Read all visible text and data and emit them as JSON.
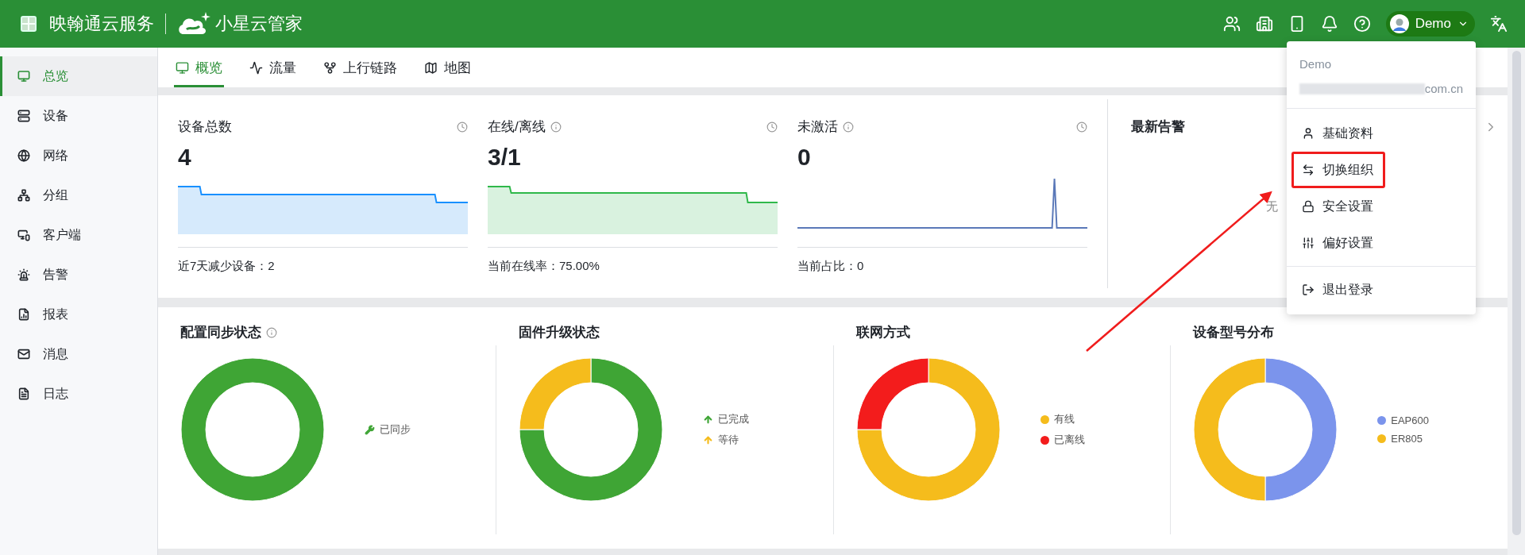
{
  "header": {
    "product": "映翰通云服务",
    "app_name": "小星云管家",
    "user": {
      "name": "Demo"
    }
  },
  "sidebar": {
    "items": [
      {
        "label": "总览",
        "selected": true
      },
      {
        "label": "设备",
        "selected": false
      },
      {
        "label": "网络",
        "selected": false
      },
      {
        "label": "分组",
        "selected": false
      },
      {
        "label": "客户端",
        "selected": false
      },
      {
        "label": "告警",
        "selected": false
      },
      {
        "label": "报表",
        "selected": false
      },
      {
        "label": "消息",
        "selected": false
      },
      {
        "label": "日志",
        "selected": false
      }
    ]
  },
  "tabs": [
    {
      "label": "概览",
      "selected": true
    },
    {
      "label": "流量",
      "selected": false
    },
    {
      "label": "上行链路",
      "selected": false
    },
    {
      "label": "地图",
      "selected": false
    }
  ],
  "stats": [
    {
      "title": "设备总数",
      "info": false,
      "value": "4",
      "footer": "近7天减少设备：2"
    },
    {
      "title": "在线/离线",
      "info": true,
      "value": "3/1",
      "footer": "当前在线率：75.00%"
    },
    {
      "title": "未激活",
      "info": true,
      "value": "0",
      "footer": "当前占比：0"
    }
  ],
  "alerts": {
    "title": "最新告警",
    "empty_text": "无"
  },
  "charts": [
    {
      "title": "配置同步状态",
      "info": true,
      "legend": [
        {
          "label": "已同步",
          "color": "#3fa535"
        }
      ]
    },
    {
      "title": "固件升级状态",
      "info": false,
      "legend": [
        {
          "label": "已完成",
          "color": "#3fa535"
        },
        {
          "label": "等待",
          "color": "#f5bc1c"
        }
      ]
    },
    {
      "title": "联网方式",
      "info": false,
      "legend": [
        {
          "label": "有线",
          "color": "#f5bc1c"
        },
        {
          "label": "已离线",
          "color": "#f31c1c"
        }
      ]
    },
    {
      "title": "设备型号分布",
      "info": false,
      "legend": [
        {
          "label": "EAP600",
          "color": "#7b94ec"
        },
        {
          "label": "ER805",
          "color": "#f5bc1c"
        }
      ]
    }
  ],
  "user_menu": {
    "name": "Demo",
    "email_visible": "com.cn",
    "items": [
      {
        "label": "基础资料",
        "highlighted": false
      },
      {
        "label": "切换组织",
        "highlighted": true
      },
      {
        "label": "安全设置",
        "highlighted": false
      },
      {
        "label": "偏好设置",
        "highlighted": false
      }
    ],
    "footer_items": [
      {
        "label": "退出登录",
        "highlighted": false
      }
    ]
  }
}
